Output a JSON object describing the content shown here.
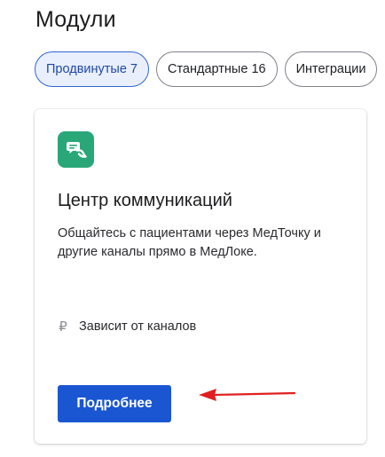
{
  "page": {
    "title": "Модули"
  },
  "tabs": [
    {
      "label": "Продвинутые 7",
      "active": true
    },
    {
      "label": "Стандартные 16",
      "active": false
    },
    {
      "label": "Интеграции",
      "active": false
    }
  ],
  "module_card": {
    "icon": "chat-bubbles-icon",
    "title": "Центр коммуникаций",
    "description": "Общайтесь с пациентами через МедТочку и другие каналы прямо в МедЛоке.",
    "price_icon": "₽",
    "price_text": "Зависит от каналов",
    "button_label": "Подробнее"
  },
  "annotation": {
    "arrow_color": "#e02020"
  },
  "colors": {
    "accent": "#1a56d1",
    "active_tab_bg": "#e9effc",
    "icon_bg": "#2aa779"
  }
}
